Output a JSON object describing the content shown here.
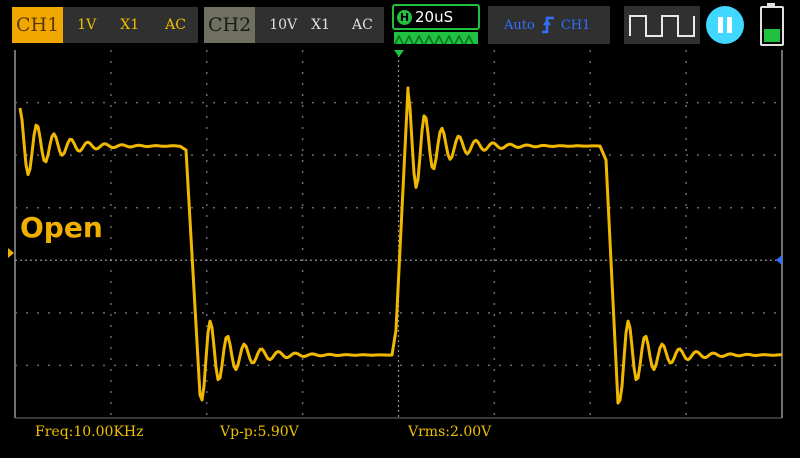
{
  "topbar": {
    "ch1": {
      "tag": "CH1",
      "volts": "1V",
      "probe": "X1",
      "coupling": "AC"
    },
    "ch2": {
      "tag": "CH2",
      "volts": "10V",
      "probe": "X1",
      "coupling": "AC"
    },
    "timebase": {
      "badge": "H",
      "value": "20uS"
    },
    "trigger": {
      "mode": "Auto",
      "icon": "rising-edge-icon",
      "source": "CH1"
    },
    "waveform_icon": "square-wave-icon",
    "run_state": "paused",
    "battery_level": 0.4
  },
  "screen": {
    "state_label": "Open"
  },
  "measurements": {
    "freq": "Freq:10.00KHz",
    "vpp": "Vp-p:5.90V",
    "vrms": "Vrms:2.00V"
  },
  "colors": {
    "ch1": "#f0b000",
    "ch2": "#707060",
    "timebase": "#20c040",
    "trigger": "#3070ff",
    "run_button": "#40d8ff"
  }
}
